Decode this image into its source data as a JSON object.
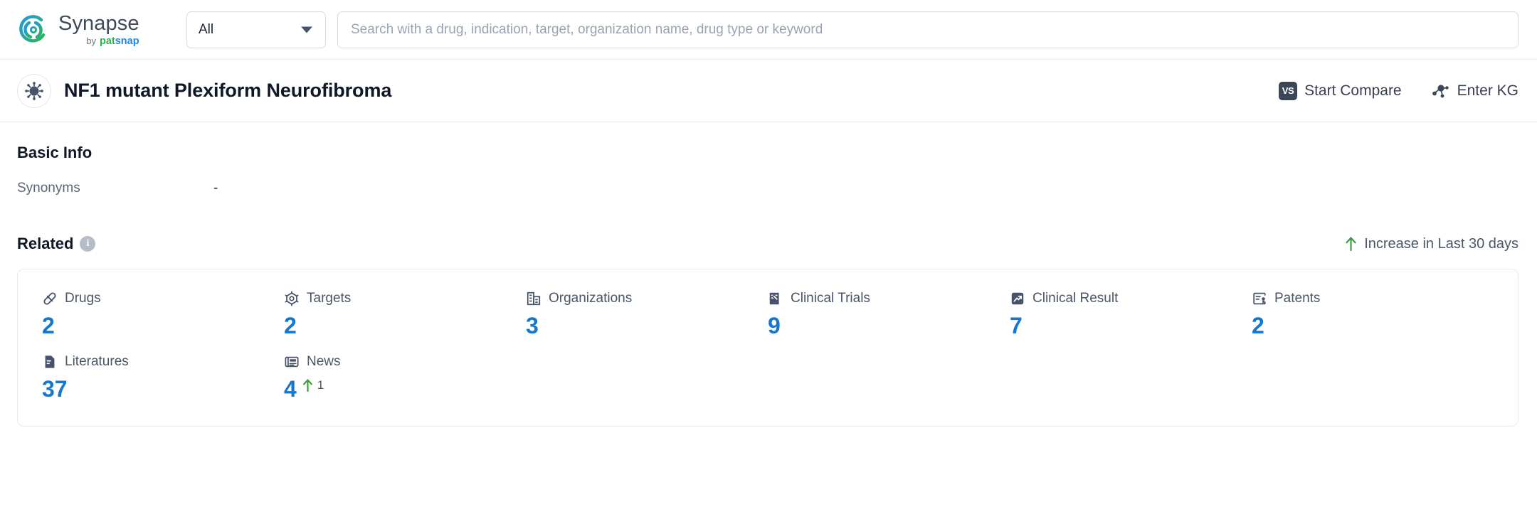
{
  "header": {
    "brand_name": "Synapse",
    "brand_by": "by",
    "brand_pat": "pat",
    "brand_snap": "snap",
    "logo_icon": "synapse-swirl-logo",
    "scope_value": "All",
    "scope_caret_icon": "chevron-down-icon",
    "search_placeholder": "Search with a drug, indication, target, organization name, drug type or keyword",
    "search_value": ""
  },
  "entity": {
    "avatar_icon": "virus-icon",
    "title": "NF1 mutant Plexiform Neurofibroma",
    "actions": [
      {
        "label": "Start Compare",
        "icon": "vs-badge-icon",
        "badge": "VS"
      },
      {
        "label": "Enter KG",
        "icon": "knowledge-graph-icon"
      }
    ]
  },
  "basic_info": {
    "title": "Basic Info",
    "rows": [
      {
        "key": "Synonyms",
        "value": "-"
      }
    ]
  },
  "related": {
    "title": "Related",
    "info_icon": "info-icon",
    "info_glyph": "i",
    "legend": {
      "icon": "arrow-up-icon",
      "label": "Increase in Last 30 days",
      "color": "#3aa03a"
    },
    "accent_color": "#1677cc",
    "stats": [
      {
        "label": "Drugs",
        "icon": "pill-icon",
        "value": "2",
        "delta": null
      },
      {
        "label": "Targets",
        "icon": "target-icon",
        "value": "2",
        "delta": null
      },
      {
        "label": "Organizations",
        "icon": "building-icon",
        "value": "3",
        "delta": null
      },
      {
        "label": "Clinical Trials",
        "icon": "clinical-trial-icon",
        "value": "9",
        "delta": null
      },
      {
        "label": "Clinical Result",
        "icon": "clinical-result-icon",
        "value": "7",
        "delta": null
      },
      {
        "label": "Patents",
        "icon": "patent-icon",
        "value": "2",
        "delta": null
      },
      {
        "label": "Literatures",
        "icon": "literature-icon",
        "value": "37",
        "delta": null
      },
      {
        "label": "News",
        "icon": "news-icon",
        "value": "4",
        "delta": "1"
      }
    ]
  }
}
